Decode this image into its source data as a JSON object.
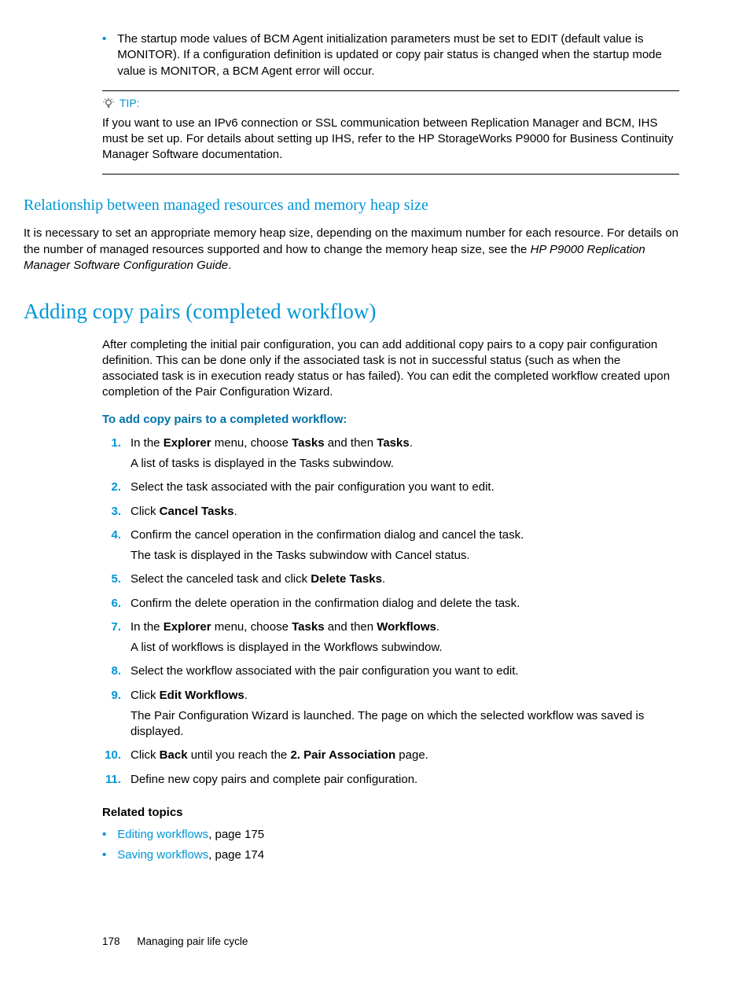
{
  "intro_bullet": "The startup mode values of BCM Agent initialization parameters must be set to EDIT (default value is MONITOR). If a configuration definition is updated or copy pair status is changed when the startup mode value is MONITOR, a BCM Agent error will occur.",
  "tip": {
    "label": "TIP:",
    "body": "If you want to use an IPv6 connection or SSL communication between Replication Manager and BCM, IHS must be set up. For details about setting up IHS, refer to the HP StorageWorks P9000 for Business Continuity Manager Software documentation."
  },
  "section_relationship": {
    "title": "Relationship between managed resources and memory heap size",
    "body_pre": "It is necessary to set an appropriate memory heap size, depending on the maximum number for each resource. For details on the number of managed resources supported and how to change the memory heap size, see the ",
    "body_italic": "HP P9000 Replication Manager Software Configuration Guide",
    "body_post": "."
  },
  "section_adding": {
    "title": "Adding copy pairs (completed workflow)",
    "intro": "After completing the initial pair configuration, you can add additional copy pairs to a copy pair configuration definition. This can be done only if the associated task is not in successful status (such as when the associated task is in execution ready status or has failed). You can edit the completed workflow created upon completion of the Pair Configuration Wizard.",
    "proc_title": "To add copy pairs to a completed workflow:",
    "steps": [
      {
        "n": "1.",
        "pre": "In the ",
        "b1": "Explorer",
        "mid1": " menu, choose ",
        "b2": "Tasks",
        "mid2": " and then ",
        "b3": "Tasks",
        "post": ".",
        "sub": "A list of tasks is displayed in the Tasks subwindow."
      },
      {
        "n": "2.",
        "text": "Select the task associated with the pair configuration you want to edit."
      },
      {
        "n": "3.",
        "pre": "Click ",
        "b1": "Cancel Tasks",
        "post": "."
      },
      {
        "n": "4.",
        "text": "Confirm the cancel operation in the confirmation dialog and cancel the task.",
        "sub": "The task is displayed in the Tasks subwindow with Cancel status."
      },
      {
        "n": "5.",
        "pre": "Select the canceled task and click ",
        "b1": "Delete Tasks",
        "post": "."
      },
      {
        "n": "6.",
        "text": "Confirm the delete operation in the confirmation dialog and delete the task."
      },
      {
        "n": "7.",
        "pre": "In the ",
        "b1": "Explorer",
        "mid1": " menu, choose ",
        "b2": "Tasks",
        "mid2": " and then ",
        "b3": "Workflows",
        "post": ".",
        "sub": "A list of workflows is displayed in the Workflows subwindow."
      },
      {
        "n": "8.",
        "text": "Select the workflow associated with the pair configuration you want to edit."
      },
      {
        "n": "9.",
        "pre": "Click ",
        "b1": "Edit Workflows",
        "post": ".",
        "sub": "The Pair Configuration Wizard is launched. The page on which the selected workflow was saved is displayed."
      },
      {
        "n": "10.",
        "pre": "Click ",
        "b1": "Back",
        "mid1": " until you reach the ",
        "b2": "2. Pair Association",
        "post": " page."
      },
      {
        "n": "11.",
        "text": "Define new copy pairs and complete pair configuration."
      }
    ]
  },
  "related": {
    "title": "Related topics",
    "items": [
      {
        "link": "Editing workflows",
        "suffix": ", page 175"
      },
      {
        "link": "Saving workflows",
        "suffix": ", page 174"
      }
    ]
  },
  "footer": {
    "page": "178",
    "section": "Managing pair life cycle"
  }
}
